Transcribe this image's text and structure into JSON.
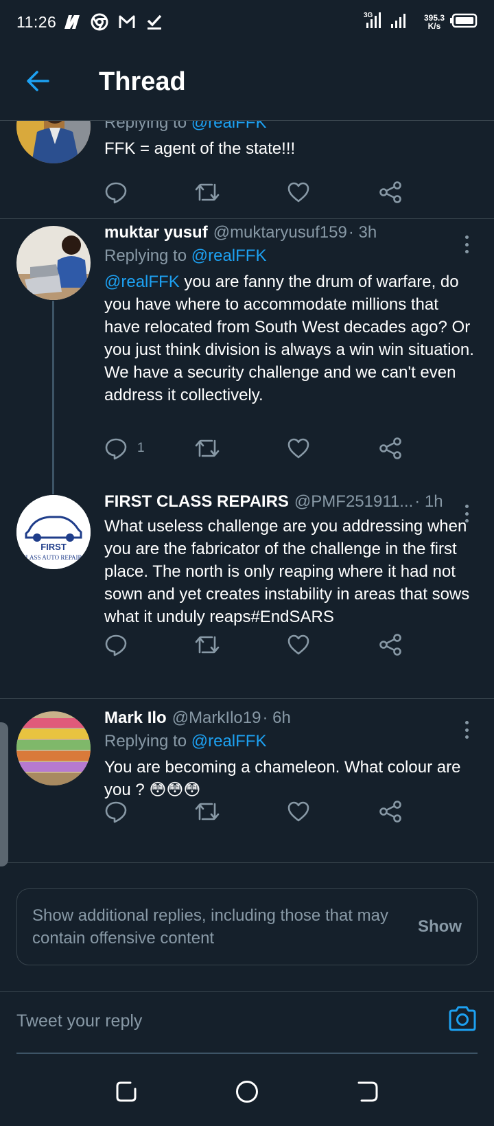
{
  "status_bar": {
    "time": "11:26",
    "speed_value": "395.3",
    "speed_unit": "K/s",
    "network": "3G",
    "icons": [
      "netflix-n-icon",
      "chrome-icon",
      "gmail-icon",
      "check-icon",
      "signal-icon",
      "battery-icon"
    ]
  },
  "header": {
    "title": "Thread",
    "back_icon": "arrow-left-icon"
  },
  "colors": {
    "background": "#15202b",
    "accent": "#1da1f2",
    "secondary_text": "#8899a6",
    "divider": "#38444d"
  },
  "tweets": [
    {
      "replying_prefix": "Replying to",
      "replying_to": "@realFFK",
      "text": "FFK = agent of the state!!!"
    },
    {
      "name": "muktar yusuf",
      "handle": "@muktaryusuf159",
      "time": "· 3h",
      "replying_prefix": "Replying to",
      "replying_to": "@realFFK",
      "mention": "@realFFK",
      "text": " you are fanny the drum of warfare, do you have where to accommodate millions that have relocated from South West decades ago? Or you just think division is always a win win situation.\nWe have a security challenge and we can't even address it collectively.",
      "reply_count": "1"
    },
    {
      "name": "FIRST CLASS REPAIRS",
      "handle": "@PMF251911...",
      "time": "· 1h",
      "text": "What useless challenge are you addressing when you are the fabricator of the challenge in the first place. The north is only reaping where it had not sown and yet creates instability in areas that sows what it unduly reaps#EndSARS",
      "avatar_logo_line1": "FIRST",
      "avatar_logo_line2": "CLASS AUTO REPAIRS"
    },
    {
      "name": "Mark Ilo",
      "handle": "@MarkIlo19",
      "time": "· 6h",
      "replying_prefix": "Replying to",
      "replying_to": "@realFFK",
      "text": "You are becoming a chameleon. What colour are you ? 😳😳😳"
    }
  ],
  "show_more": {
    "text": "Show additional replies, including those that may contain offensive content",
    "button": "Show"
  },
  "reply": {
    "placeholder": "Tweet your reply"
  }
}
